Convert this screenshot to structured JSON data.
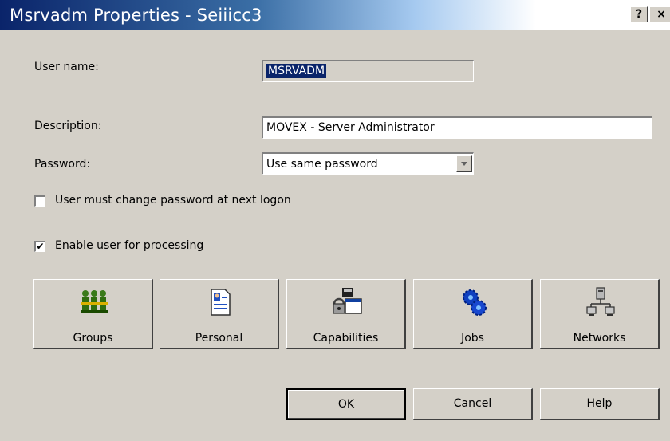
{
  "window": {
    "title": "Msrvadm Properties - Seiiicc3",
    "help_button": "?",
    "close_button": "×"
  },
  "form": {
    "user_name": {
      "label": "User name:",
      "value": "MSRVADM"
    },
    "description": {
      "label": "Description:",
      "value": "MOVEX - Server Administrator"
    },
    "password": {
      "label": "Password:",
      "selected": "Use same password"
    }
  },
  "checkboxes": [
    {
      "label": "User must change password at next logon",
      "checked": false
    },
    {
      "label": "Enable user for processing",
      "checked": true,
      "mark": "✔"
    }
  ],
  "tiles": [
    {
      "label": "Groups",
      "icon": "groups-icon"
    },
    {
      "label": "Personal",
      "icon": "personal-icon"
    },
    {
      "label": "Capabilities",
      "icon": "capabilities-icon"
    },
    {
      "label": "Jobs",
      "icon": "jobs-icon"
    },
    {
      "label": "Networks",
      "icon": "networks-icon"
    }
  ],
  "buttons": {
    "ok": "OK",
    "cancel": "Cancel",
    "help": "Help"
  },
  "colors": {
    "dialog_bg": "#d4d0c8",
    "title_bar": "#0a246a",
    "selection": "#0a246a"
  }
}
